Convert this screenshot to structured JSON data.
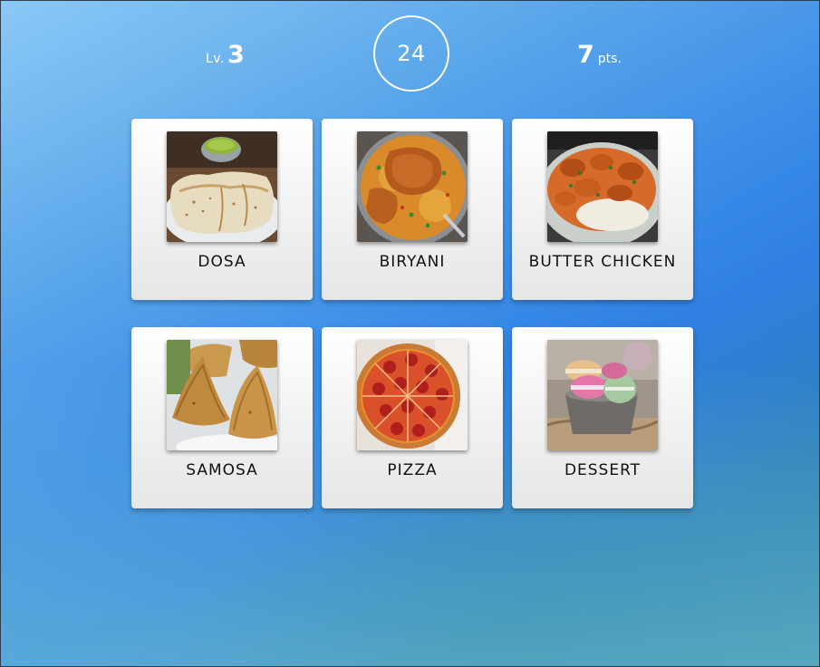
{
  "hud": {
    "level_prefix": "Lv.",
    "level": "3",
    "timer": "24",
    "score": "7",
    "score_suffix": "pts."
  },
  "cards": [
    {
      "label": "DOSA",
      "icon": "dosa-image"
    },
    {
      "label": "BIRYANI",
      "icon": "biryani-image"
    },
    {
      "label": "BUTTER CHICKEN",
      "icon": "butter-chicken-image"
    },
    {
      "label": "SAMOSA",
      "icon": "samosa-image"
    },
    {
      "label": "PIZZA",
      "icon": "pizza-image"
    },
    {
      "label": "DESSERT",
      "icon": "dessert-image"
    }
  ],
  "colors": {
    "background_start": "#8ac9f6",
    "background_mid": "#2f80e2",
    "background_end": "#2a7fa6",
    "card": "#f4f4f4",
    "hud_text": "#ffffff"
  }
}
